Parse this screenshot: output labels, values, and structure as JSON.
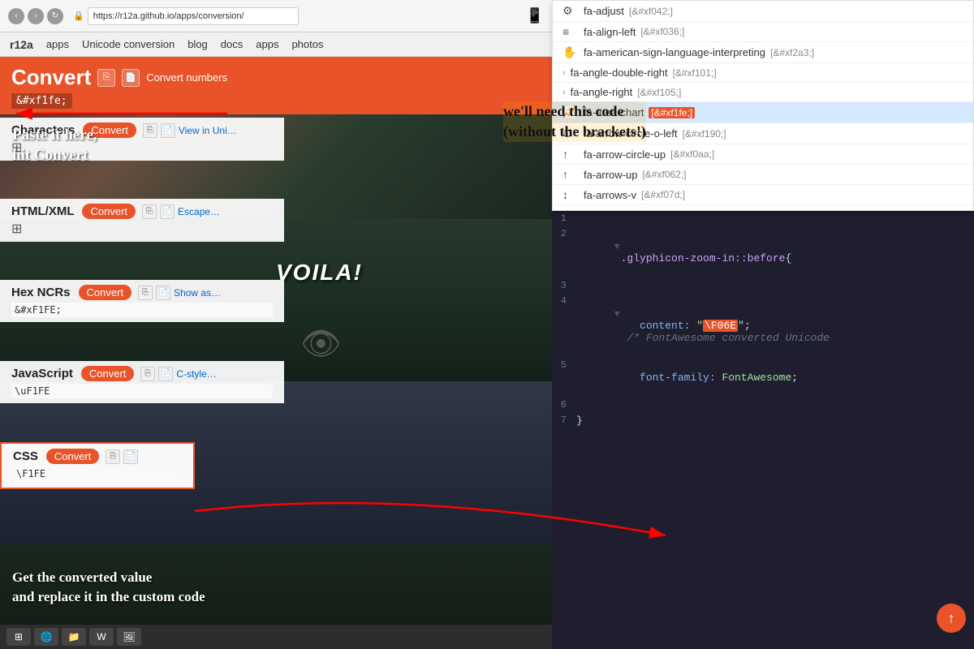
{
  "browser": {
    "url": "https://r12a.github.io/apps/conversion/",
    "title": "Convert",
    "nav_links": [
      "blog",
      "docs",
      "apps",
      "photos"
    ]
  },
  "header": {
    "title": "Convert",
    "subtitle": "Convert numbers",
    "input_value": "&#xf1fe;",
    "handwritten_line1": "Paste it here,",
    "handwritten_line2": "hit Convert"
  },
  "sections": {
    "characters": {
      "label": "Characters",
      "btn": "Convert",
      "icon1": "copy",
      "icon2": "file",
      "link": "View in Uni…",
      "grid_icon": "⊞",
      "output": ""
    },
    "htmlxml": {
      "label": "HTML/XML",
      "btn": "Convert",
      "icon1": "copy",
      "icon2": "file",
      "link": "Escape…",
      "grid_icon": "⊞"
    },
    "hexncrs": {
      "label": "Hex NCRs",
      "btn": "Convert",
      "icon1": "copy",
      "icon2": "file",
      "link": "Show as…",
      "output": "&#xF1FE;"
    },
    "javascript": {
      "label": "JavaScript",
      "btn": "Convert",
      "icon1": "copy",
      "icon2": "file",
      "link": "C-style…",
      "output": "\\uF1FE"
    },
    "css": {
      "label": "CSS",
      "btn": "Convert",
      "icon1": "copy",
      "icon2": "file",
      "output": "\\F1FE"
    }
  },
  "voila": "VOILA!",
  "annotation1": {
    "line1": "Paste it here,",
    "line2": "hit Convert"
  },
  "annotation2": {
    "line1": "we'll need this code",
    "line2": "(without the brackets!)"
  },
  "annotation3": {
    "line1": "Get the converted value",
    "line2": "and replace it in the custom code"
  },
  "dropdown": {
    "items": [
      {
        "icon": "⚙",
        "name": "fa-adjust",
        "code": "[&#xf042;]"
      },
      {
        "icon": "≡",
        "name": "fa-align-left",
        "code": "[&#xf036;]"
      },
      {
        "icon": "✋",
        "name": "fa-american-sign-language-interpreting",
        "code": "[&#xf2a3;]",
        "expand": true
      },
      {
        "icon": ">",
        "name": "fa-angle-double-right",
        "code": "[&#xf101;]",
        "arrow": true
      },
      {
        "icon": ">",
        "name": "fa-angle-right",
        "code": "[&#xf105;]",
        "arrow": true
      },
      {
        "icon": "~",
        "name": "fa-area-chart",
        "code": "[&#xf1fe;]",
        "highlight": true
      },
      {
        "icon": "⊙",
        "name": "fa-arrow-circle-o-left",
        "code": "[&#xf190;]"
      },
      {
        "icon": "↑",
        "name": "fa-arrow-circle-up",
        "code": "[&#xf0aa;]"
      },
      {
        "icon": "↑",
        "name": "fa-arrow-up",
        "code": "[&#xf062;]"
      },
      {
        "icon": "↕",
        "name": "fa-arrows-v",
        "code": "[&#xf07d;]"
      }
    ]
  },
  "code_editor": {
    "lines": [
      {
        "num": "1",
        "content": ""
      },
      {
        "num": "2",
        "content": ".glyphicon-zoom-in::before{",
        "selector": true
      },
      {
        "num": "3",
        "content": ""
      },
      {
        "num": "4",
        "content": "    content: \"\\F06E\";",
        "comment": "/* FontAwesome converted Unicode */"
      },
      {
        "num": "5",
        "content": "    font-family: FontAwesome;"
      },
      {
        "num": "6",
        "content": ""
      },
      {
        "num": "7",
        "content": "}"
      }
    ]
  },
  "colors": {
    "orange": "#e8532a",
    "dark_bg": "#1e1e2e",
    "code_selector": "#cba6f7",
    "code_blue": "#89b4fa",
    "code_green": "#a6e3a1",
    "code_comment": "#6c7086"
  }
}
